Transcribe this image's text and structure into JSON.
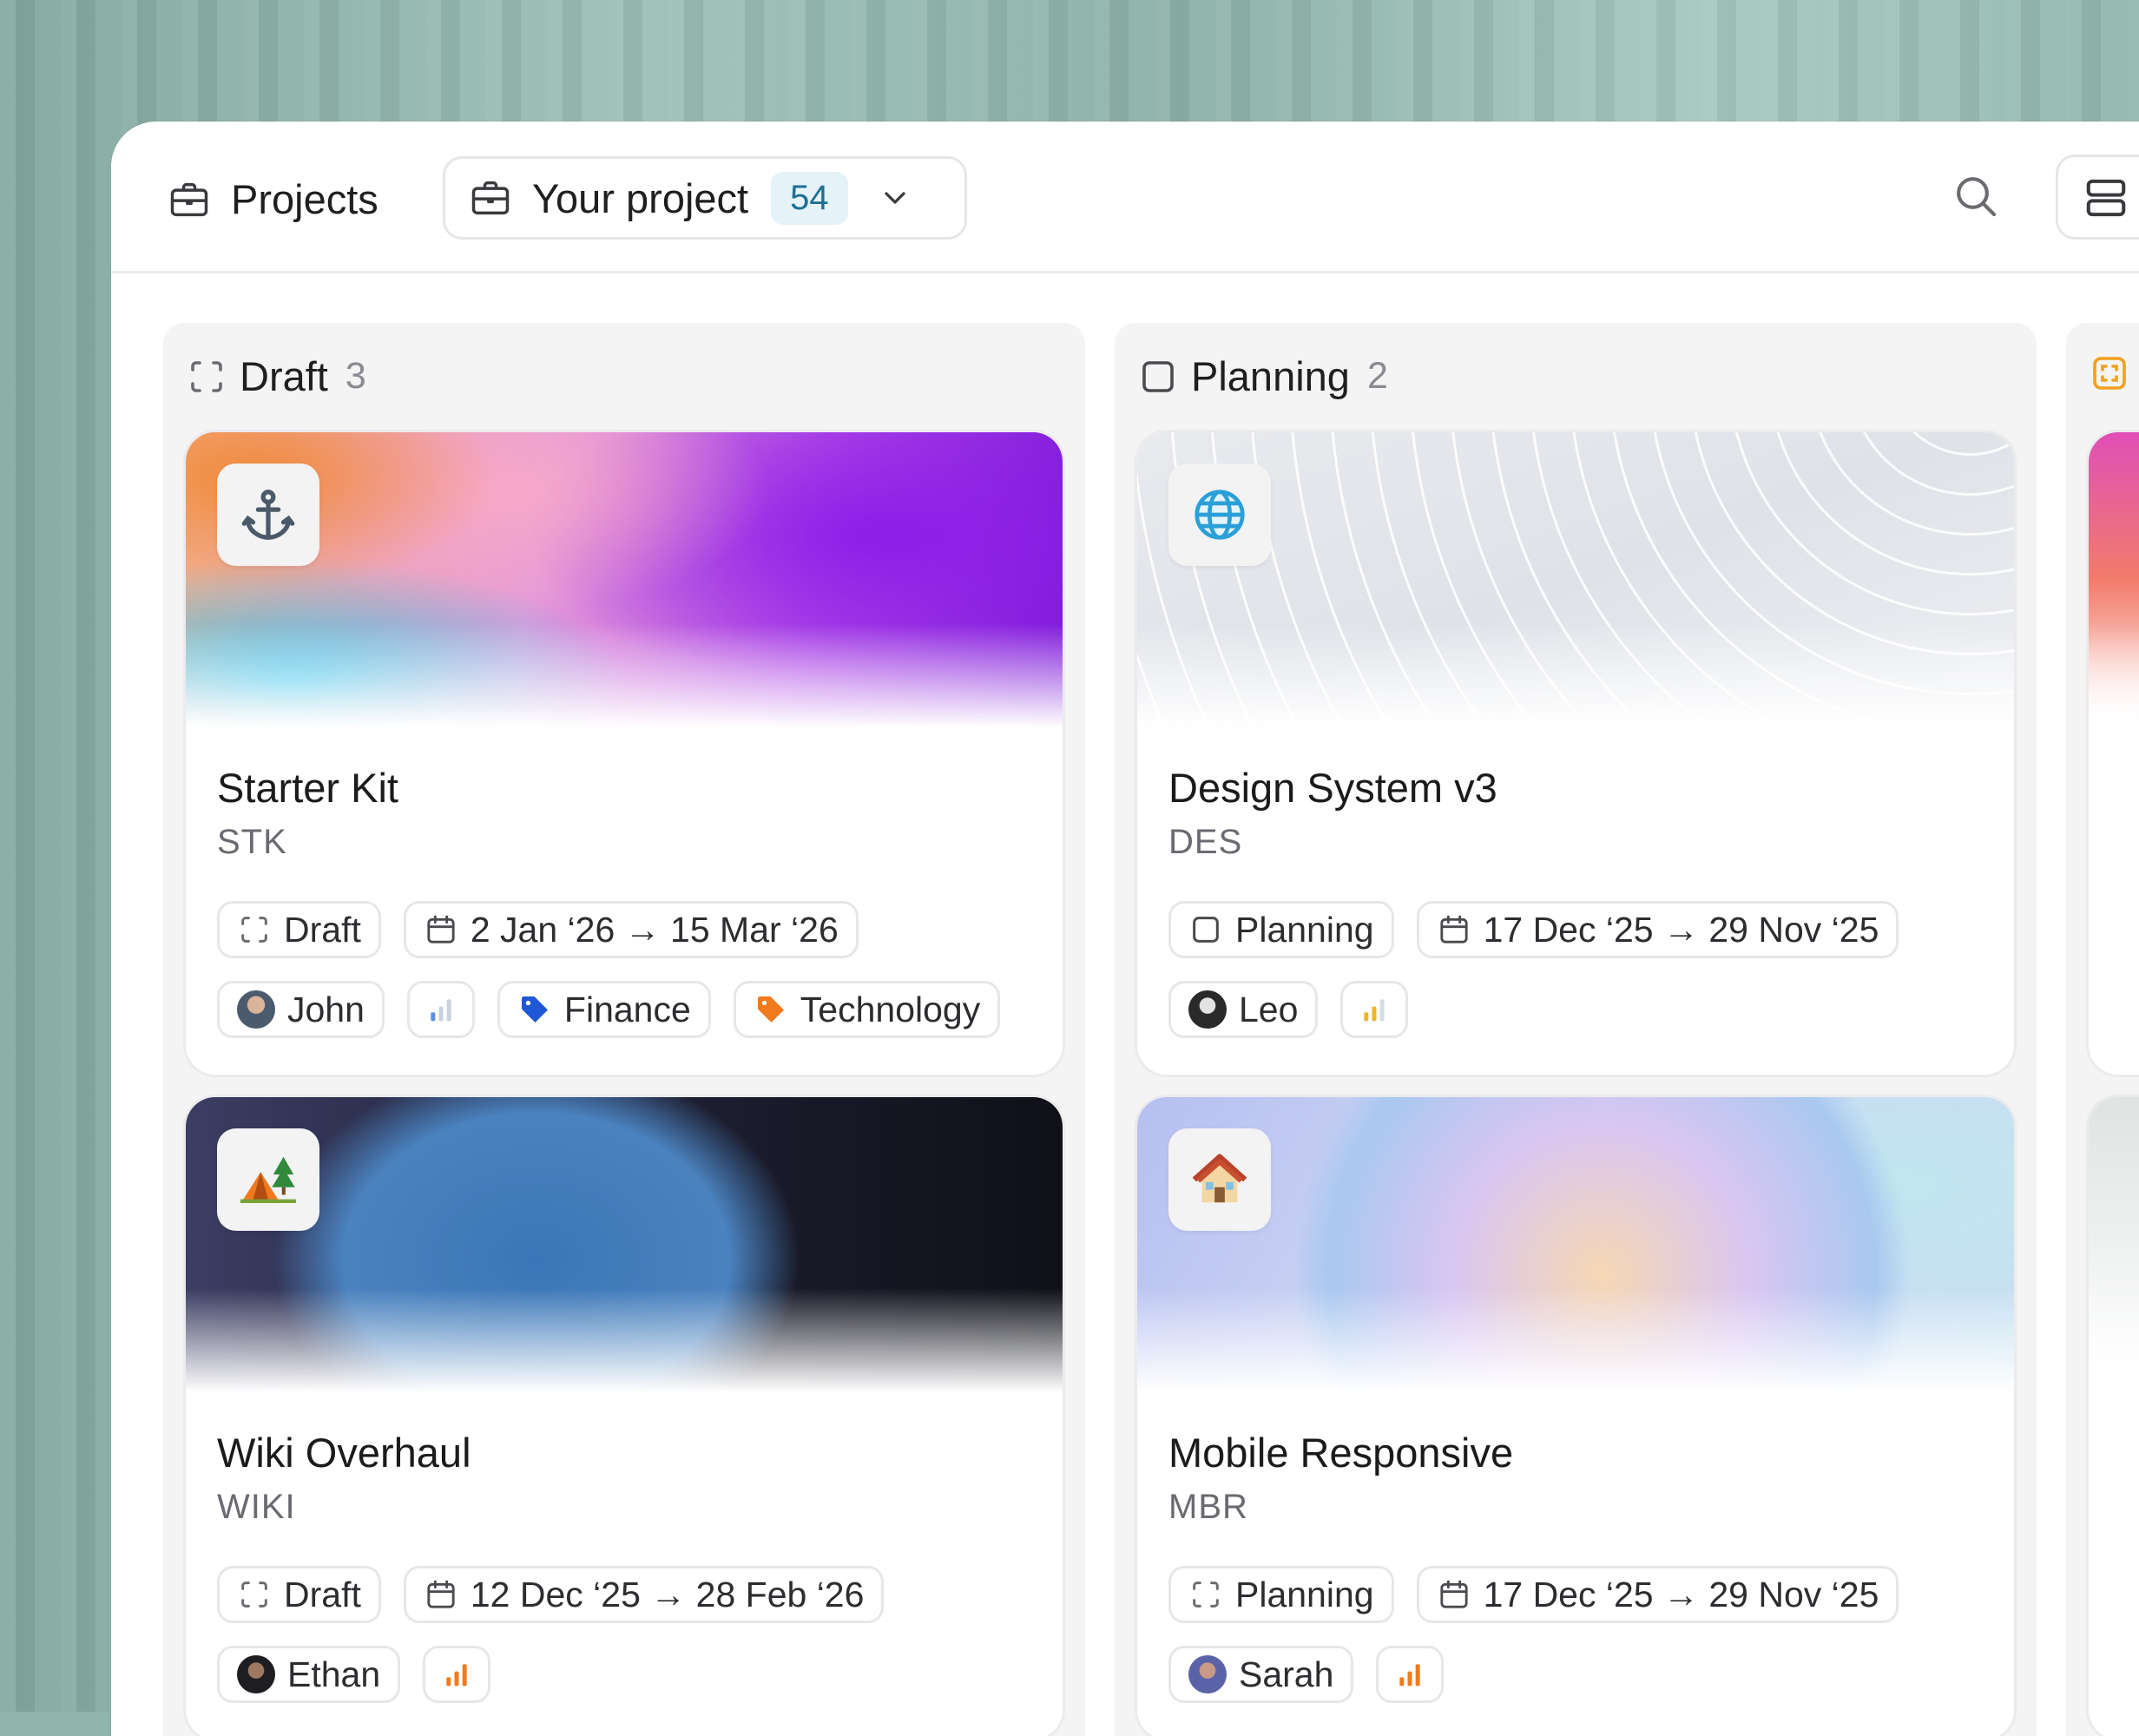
{
  "header": {
    "breadcrumb_label": "Projects",
    "project_selector": {
      "label": "Your project",
      "count": "54"
    }
  },
  "columns": [
    {
      "title": "Draft",
      "count": "3",
      "cards": [
        {
          "title": "Starter Kit",
          "code": "STK",
          "emoji": "anchor-icon",
          "status": "Draft",
          "dates": "2 Jan ‘26 → 15 Mar ‘26",
          "assignee": "John",
          "priority": "low",
          "tags": [
            "Finance",
            "Technology"
          ]
        },
        {
          "title": "Wiki Overhaul",
          "code": "WIKI",
          "emoji": "camping-icon",
          "status": "Draft",
          "dates": "12 Dec ‘25 → 28 Feb ‘26",
          "assignee": "Ethan",
          "priority": "high"
        }
      ]
    },
    {
      "title": "Planning",
      "count": "2",
      "cards": [
        {
          "title": "Design System v3",
          "code": "DES",
          "emoji": "globe-icon",
          "status": "Planning",
          "dates": "17 Dec ‘25 → 29 Nov ‘25",
          "assignee": "Leo",
          "priority": "medium"
        },
        {
          "title": "Mobile Responsive",
          "code": "MBR",
          "emoji": "house-icon",
          "status": "Planning",
          "dates": "17 Dec ‘25 → 29 Nov ‘25",
          "assignee": "Sarah",
          "priority": "high"
        }
      ]
    }
  ],
  "colors": {
    "accent_badge_bg": "#e5f2f8",
    "accent_badge_text": "#1d6f93",
    "priority_low": "#5b8ee6",
    "priority_medium": "#f0b429",
    "priority_high": "#f07a1d",
    "tag_finance": "#1f57d6",
    "tag_technology": "#f07a1d",
    "third_column_status": "#f0a020"
  }
}
